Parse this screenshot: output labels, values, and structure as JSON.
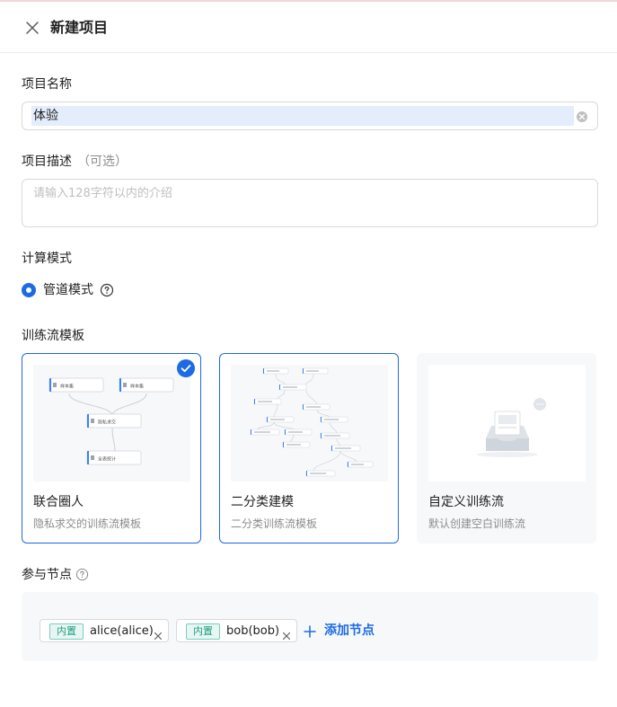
{
  "header": {
    "title": "新建项目"
  },
  "form": {
    "name_label": "项目名称",
    "name_value": "体验",
    "desc_label": "项目描述",
    "desc_optional": "（可选）",
    "desc_placeholder": "请输入128字符以内的介绍",
    "mode_label": "计算模式",
    "mode_option": "管道模式",
    "template_label": "训练流模板",
    "nodes_label": "参与节点"
  },
  "templates": [
    {
      "name": "联合圈人",
      "desc": "隐私求交的训练流模板",
      "selected": true,
      "thumb_labels": [
        "样本集",
        "样本集",
        "隐私求交",
        "全表统计"
      ]
    },
    {
      "name": "二分类建模",
      "desc": "二分类训练流模板",
      "selected": false
    },
    {
      "name": "自定义训练流",
      "desc": "默认创建空白训练流",
      "selected": false
    }
  ],
  "nodes": [
    {
      "badge": "内置",
      "name": "alice(alice)"
    },
    {
      "badge": "内置",
      "name": "bob(bob)"
    }
  ],
  "add_node_label": "添加节点",
  "colors": {
    "primary": "#1d6ae5",
    "badge_green": "#1f9d7f"
  }
}
